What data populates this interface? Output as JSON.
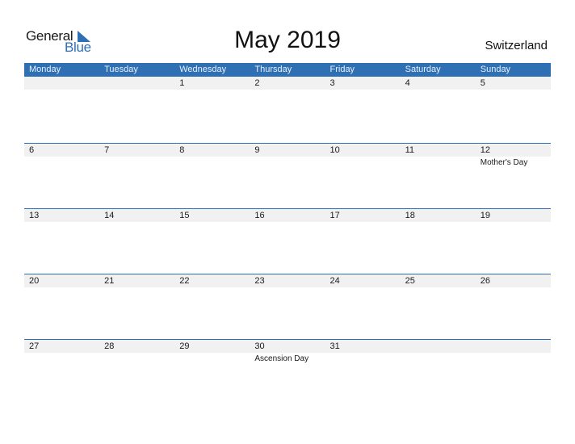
{
  "logo": {
    "part1": "General",
    "part2": "Blue",
    "icon": "triangle-flag-icon"
  },
  "title": "May 2019",
  "country": "Switzerland",
  "colors": {
    "accent": "#2f6fb3",
    "date_strip": "#f1f1f1"
  },
  "weekdays": [
    "Monday",
    "Tuesday",
    "Wednesday",
    "Thursday",
    "Friday",
    "Saturday",
    "Sunday"
  ],
  "weeks": [
    {
      "days": [
        {
          "n": "",
          "e": ""
        },
        {
          "n": "",
          "e": ""
        },
        {
          "n": "1",
          "e": ""
        },
        {
          "n": "2",
          "e": ""
        },
        {
          "n": "3",
          "e": ""
        },
        {
          "n": "4",
          "e": ""
        },
        {
          "n": "5",
          "e": ""
        }
      ]
    },
    {
      "days": [
        {
          "n": "6",
          "e": ""
        },
        {
          "n": "7",
          "e": ""
        },
        {
          "n": "8",
          "e": ""
        },
        {
          "n": "9",
          "e": ""
        },
        {
          "n": "10",
          "e": ""
        },
        {
          "n": "11",
          "e": ""
        },
        {
          "n": "12",
          "e": "Mother's Day"
        }
      ]
    },
    {
      "days": [
        {
          "n": "13",
          "e": ""
        },
        {
          "n": "14",
          "e": ""
        },
        {
          "n": "15",
          "e": ""
        },
        {
          "n": "16",
          "e": ""
        },
        {
          "n": "17",
          "e": ""
        },
        {
          "n": "18",
          "e": ""
        },
        {
          "n": "19",
          "e": ""
        }
      ]
    },
    {
      "days": [
        {
          "n": "20",
          "e": ""
        },
        {
          "n": "21",
          "e": ""
        },
        {
          "n": "22",
          "e": ""
        },
        {
          "n": "23",
          "e": ""
        },
        {
          "n": "24",
          "e": ""
        },
        {
          "n": "25",
          "e": ""
        },
        {
          "n": "26",
          "e": ""
        }
      ]
    },
    {
      "days": [
        {
          "n": "27",
          "e": ""
        },
        {
          "n": "28",
          "e": ""
        },
        {
          "n": "29",
          "e": ""
        },
        {
          "n": "30",
          "e": "Ascension Day"
        },
        {
          "n": "31",
          "e": ""
        },
        {
          "n": "",
          "e": ""
        },
        {
          "n": "",
          "e": ""
        }
      ]
    }
  ]
}
